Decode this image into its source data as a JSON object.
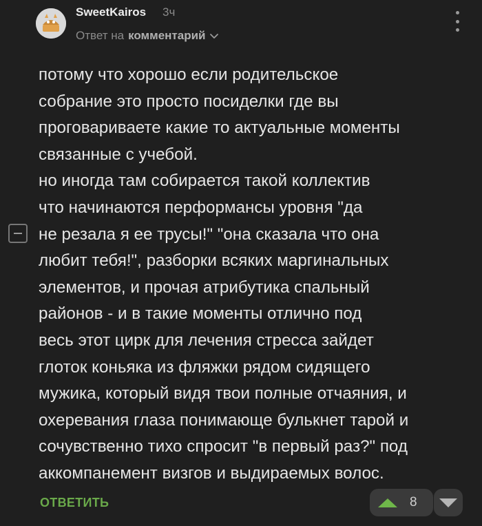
{
  "comment": {
    "username": "SweetKairos",
    "time": "3ч",
    "reply_prefix": "Ответ на",
    "reply_target": "комментарий",
    "body_lines": [
      "потому что хорошо если родительское",
      "собрание это просто посиделки где вы",
      "проговариваете какие то актуальные моменты",
      "связанные с учебой.",
      "но иногда там собирается такой коллектив",
      "что начинаются перформансы уровня \"да",
      "не резала я ее трусы!\" \"она сказала что она",
      "любит тебя!\", разборки всяких маргинальных",
      "элементов, и прочая атрибутика спальный",
      "районов - и в такие моменты отлично под",
      "весь этот цирк для лечения стресса зайдет",
      "глоток коньяка из фляжки рядом сидящего",
      "мужика, который видя твои полные отчаяния, и",
      "охеревания глаза понимающе булькнет тарой и",
      "сочувственно тихо спросит \"в первый раз?\" под",
      "аккомпанемент визгов и выдираемых волос."
    ]
  },
  "actions": {
    "reply_label": "ОТВЕТИТЬ",
    "rating": "8"
  },
  "icons": {
    "avatar": "cat-in-basket-avatar",
    "more": "more-vertical-icon",
    "collapse": "collapse-minus-icon",
    "upvote": "upvote-triangle-icon",
    "downvote": "downvote-triangle-icon"
  },
  "colors": {
    "background": "#1f1f1f",
    "accent_green": "#6fb74a",
    "text": "#e6e6e6",
    "muted": "#8a8a8a"
  }
}
